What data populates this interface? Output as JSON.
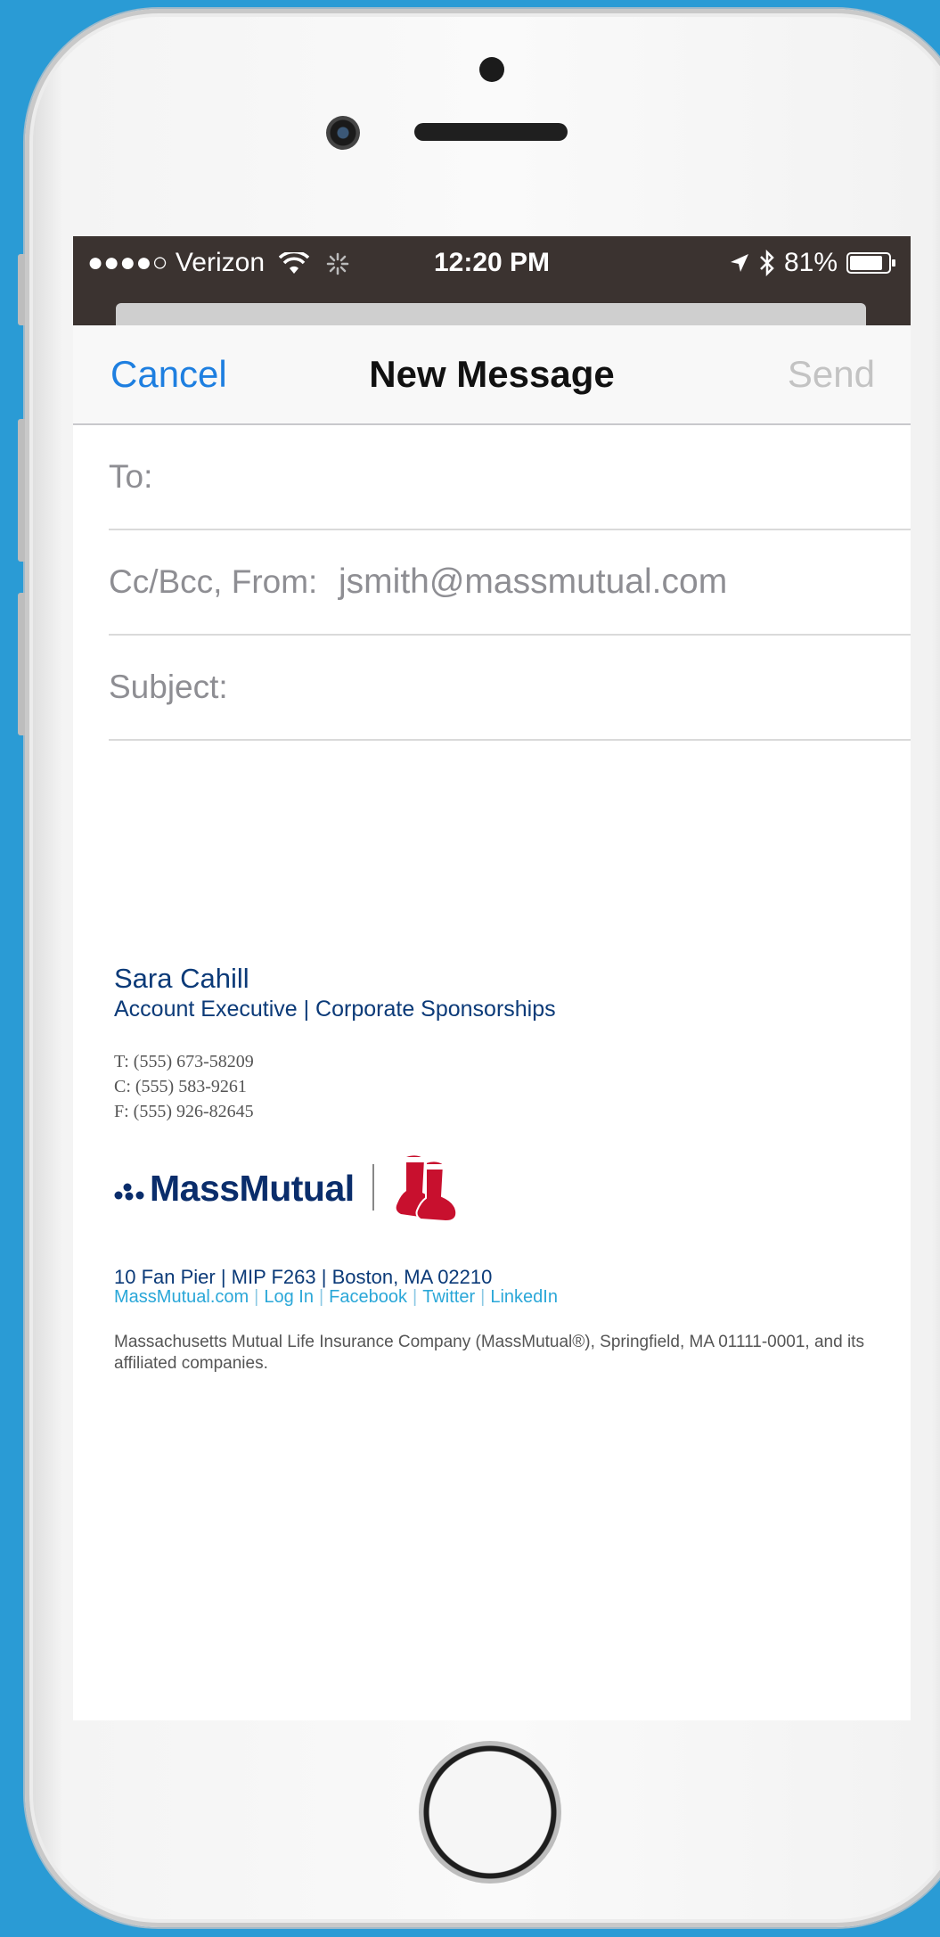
{
  "status_bar": {
    "carrier": "●●●●○ Verizon",
    "time": "12:20 PM",
    "battery": "81%"
  },
  "nav": {
    "cancel_label": "Cancel",
    "title": "New Message",
    "send_label": "Send"
  },
  "fields": {
    "to_label": "To:",
    "ccbcc_label": "Cc/Bcc, From:",
    "from_value": "jsmith@massmutual.com",
    "subject_label": "Subject:"
  },
  "signature": {
    "name": "Sara Cahill",
    "title": "Account Executive | Corporate Sponsorships",
    "phone_t": "T: (555) 673-58209",
    "phone_c": "C: (555) 583-9261",
    "phone_f": "F: (555) 926-82645",
    "logo_text": "MassMutual",
    "address": "10 Fan Pier  |  MIP F263  |  Boston, MA 02210",
    "links": [
      "MassMutual.com",
      "Log In",
      "Facebook",
      "Twitter",
      "LinkedIn"
    ],
    "legal": "Massachusetts Mutual Life Insurance Company (MassMutual®), Springfield, MA 01111-0001, and its affiliated companies."
  },
  "colors": {
    "background": "#2a9bd5",
    "status_bar": "#3b3330",
    "ios_blue": "#1e7fe0",
    "signature_navy": "#0b3a78",
    "link_cyan": "#2aa7d8",
    "red_sox_red": "#c8102e"
  },
  "icons": [
    "wifi-icon",
    "activity-spinner-icon",
    "location-arrow-icon",
    "bluetooth-icon",
    "battery-icon",
    "massmutual-dots-icon",
    "red-sox-logo-icon"
  ]
}
